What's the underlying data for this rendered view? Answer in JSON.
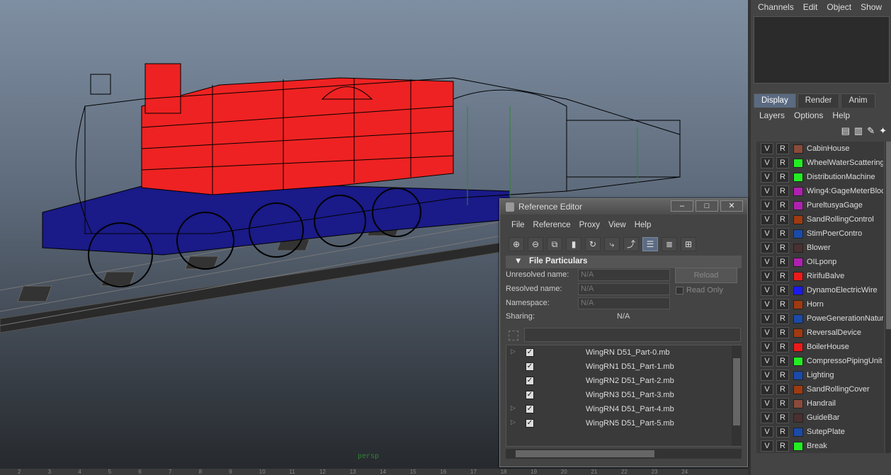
{
  "viewport": {
    "camera_label": "persp",
    "ruler_ticks": [
      "2",
      "3",
      "4",
      "5",
      "6",
      "7",
      "8",
      "9",
      "10",
      "11",
      "12",
      "13",
      "14",
      "15",
      "16",
      "17",
      "18",
      "19",
      "20",
      "21",
      "22",
      "23",
      "24"
    ]
  },
  "channel_box": {
    "menu": [
      "Channels",
      "Edit",
      "Object",
      "Show"
    ]
  },
  "layer_editor": {
    "tabs": [
      "Display",
      "Render",
      "Anim"
    ],
    "menu": [
      "Layers",
      "Options",
      "Help"
    ],
    "v_label": "V",
    "r_label": "R",
    "layers": [
      {
        "name": "CabinHouse",
        "color": "#8a4a3a"
      },
      {
        "name": "WheelWaterScattering",
        "color": "#22ee22"
      },
      {
        "name": "DistributionMachine",
        "color": "#22ee22"
      },
      {
        "name": "Wing4:GageMeterBloc",
        "color": "#b020b0"
      },
      {
        "name": "PureltusyaGage",
        "color": "#b020b0"
      },
      {
        "name": "SandRollingControl",
        "color": "#a03a10"
      },
      {
        "name": "StimPoerContro",
        "color": "#1a4aaa"
      },
      {
        "name": "Blower",
        "color": "#4a3030"
      },
      {
        "name": "OILponp",
        "color": "#b020b0"
      },
      {
        "name": "RirifuBalve",
        "color": "#ee1a1a"
      },
      {
        "name": "DynamoElectricWire",
        "color": "#1a1aee"
      },
      {
        "name": "Horn",
        "color": "#a03a10"
      },
      {
        "name": "PoweGenerationNatur",
        "color": "#1a4aaa"
      },
      {
        "name": "ReversalDevice",
        "color": "#a03a10"
      },
      {
        "name": "BoilerHouse",
        "color": "#ee1a1a"
      },
      {
        "name": "CompressoPipingUnit",
        "color": "#22ee22"
      },
      {
        "name": "Lighting",
        "color": "#1a4aaa"
      },
      {
        "name": "SandRollingCover",
        "color": "#a03a10"
      },
      {
        "name": "Handrail",
        "color": "#8a4a3a"
      },
      {
        "name": "GuideBar",
        "color": "#4a3030"
      },
      {
        "name": "SutepPlate",
        "color": "#1a4aaa"
      },
      {
        "name": "Break",
        "color": "#22ee22"
      }
    ]
  },
  "reference_editor": {
    "title": "Reference Editor",
    "menu": [
      "File",
      "Reference",
      "Proxy",
      "View",
      "Help"
    ],
    "section": "File Particulars",
    "unresolved_label": "Unresolved name:",
    "unresolved_value": "N/A",
    "resolved_label": "Resolved name:",
    "resolved_value": "N/A",
    "namespace_label": "Namespace:",
    "namespace_value": "N/A",
    "sharing_label": "Sharing:",
    "sharing_value": "N/A",
    "reload": "Reload",
    "read_only": "Read Only",
    "files": [
      {
        "name": "WingRN D51_Part-0.mb",
        "expand": true
      },
      {
        "name": "WingRN1 D51_Part-1.mb",
        "expand": false
      },
      {
        "name": "WingRN2 D51_Part-2.mb",
        "expand": false
      },
      {
        "name": "WingRN3 D51_Part-3.mb",
        "expand": false
      },
      {
        "name": "WingRN4 D51_Part-4.mb",
        "expand": true
      },
      {
        "name": "WingRN5 D51_Part-5.mb",
        "expand": true
      }
    ]
  }
}
